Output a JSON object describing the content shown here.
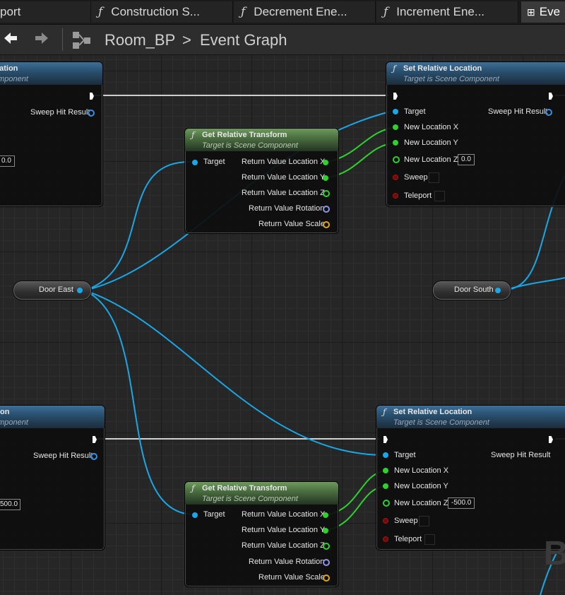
{
  "tabs": [
    {
      "label": "port"
    },
    {
      "label": "Construction S..."
    },
    {
      "label": "Decrement Ene..."
    },
    {
      "label": "Increment Ene..."
    },
    {
      "label": "Eve"
    }
  ],
  "nav": {
    "breadcrumb_root": "Room_BP",
    "breadcrumb_sep": ">",
    "breadcrumb_current": "Event Graph"
  },
  "graph": {
    "watermark": "B",
    "nodes": {
      "top_left_partial": {
        "title": "cation",
        "subtitle": "omponent",
        "out_pin": "Sweep Hit Result",
        "field": "0.0"
      },
      "bottom_left_partial": {
        "title": "ion",
        "subtitle": "omponent",
        "out_pin": "Sweep Hit Result",
        "field": "500.0"
      },
      "set_top": {
        "title": "Set Relative Location",
        "subtitle": "Target is Scene Component",
        "pins": {
          "target": "Target",
          "new_x": "New Location X",
          "new_y": "New Location Y",
          "new_z": "New Location Z",
          "sweep": "Sweep",
          "teleport": "Teleport",
          "sweep_hit": "Sweep Hit Result"
        },
        "new_z_value": "0.0"
      },
      "set_bottom": {
        "title": "Set Relative Location",
        "subtitle": "Target is Scene Component",
        "pins": {
          "target": "Target",
          "new_x": "New Location X",
          "new_y": "New Location Y",
          "new_z": "New Location Z",
          "sweep": "Sweep",
          "teleport": "Teleport",
          "sweep_hit": "Sweep Hit Result"
        },
        "new_z_value": "-500.0"
      },
      "get_top": {
        "title": "Get Relative Transform",
        "subtitle": "Target is Scene Component",
        "pins": {
          "target": "Target",
          "rx": "Return Value Location X",
          "ry": "Return Value Location Y",
          "rz": "Return Value Location Z",
          "rot": "Return Value Rotation",
          "scale": "Return Value Scale"
        }
      },
      "get_bottom": {
        "title": "Get Relative Transform",
        "subtitle": "Target is Scene Component",
        "pins": {
          "target": "Target",
          "rx": "Return Value Location X",
          "ry": "Return Value Location Y",
          "rz": "Return Value Location Z",
          "rot": "Return Value Rotation",
          "scale": "Return Value Scale"
        }
      },
      "door_east": {
        "label": "Door East"
      },
      "door_south": {
        "label": "Door South"
      }
    }
  },
  "colors": {
    "exec_wire": "#d9d9d9",
    "object_wire": "#1aa7e6",
    "float_wire": "#2ed12e",
    "function_header": "#29506f",
    "pure_header": "#4b6f41"
  }
}
